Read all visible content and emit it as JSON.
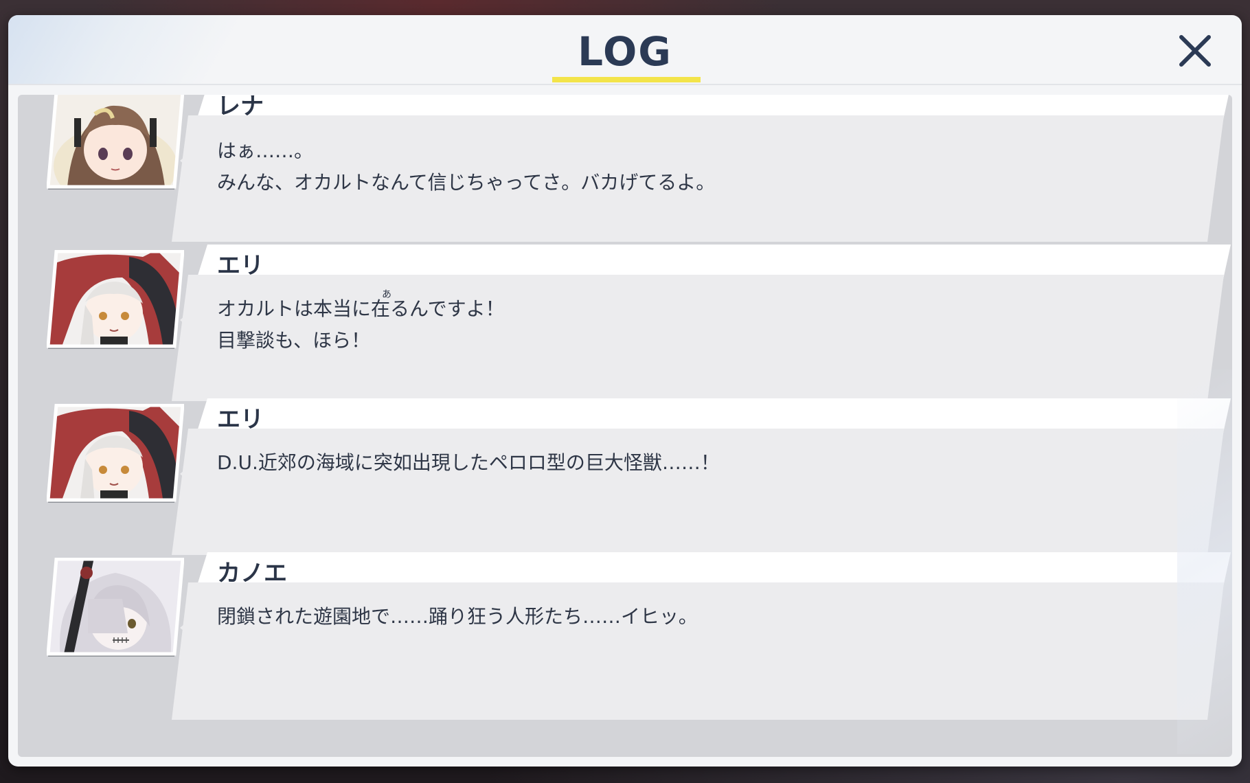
{
  "header": {
    "title": "LOG",
    "close_icon": "close-icon"
  },
  "colors": {
    "title": "#2b3a55",
    "accent_underline": "#f3e44a",
    "panel": "#f4f5f7",
    "list_bg": "#d3d4d8",
    "name_plate": "#ffffff",
    "text_box": "#ececee",
    "text": "#2e3646"
  },
  "entries": [
    {
      "speaker": "レナ",
      "portrait": "portrait-rena",
      "lines": [
        "はぁ……。",
        "みんな、オカルトなんて信じちゃってさ。バカげてるよ。"
      ]
    },
    {
      "speaker": "エリ",
      "portrait": "portrait-eri",
      "ruby": "あ",
      "lines": [
        "オカルトは本当に在るんですよ！",
        "目撃談も、ほら！"
      ]
    },
    {
      "speaker": "エリ",
      "portrait": "portrait-eri",
      "lines": [
        "D.U.近郊の海域に突如出現したペロロ型の巨大怪獣……！"
      ]
    },
    {
      "speaker": "カノエ",
      "portrait": "portrait-kanoe",
      "lines": [
        "閉鎖された遊園地で……踊り狂う人形たち……イヒッ。"
      ]
    }
  ]
}
